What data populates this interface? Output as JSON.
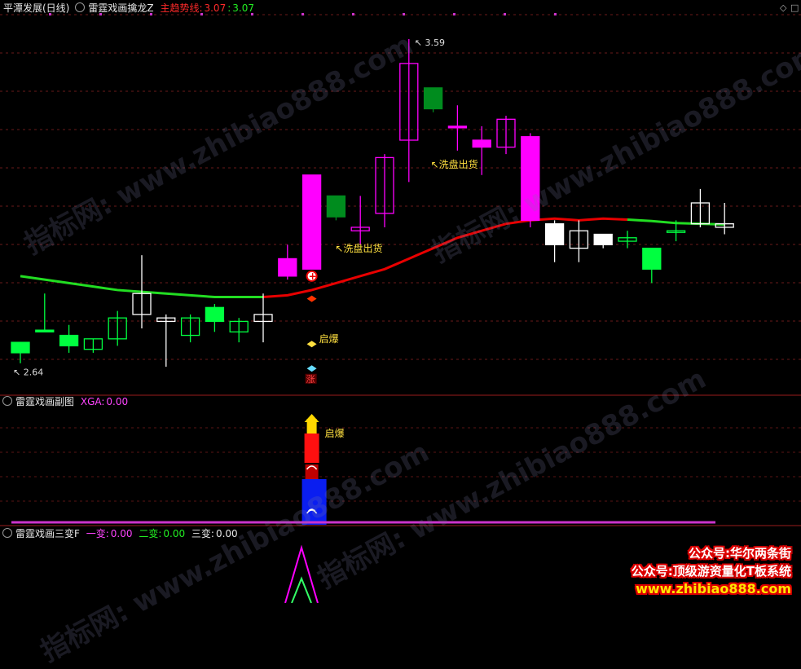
{
  "header_main": {
    "title": "平潭发展(日线)",
    "indicator": "雷霆戏画擒龙Z",
    "trend_label": "主趋势线:",
    "trend_value1": "3.07",
    "sep": ":",
    "trend_value2": "3.07"
  },
  "header_sub1": {
    "indicator": "雷霆戏画副图",
    "xga_label": "XGA:",
    "xga_value": "0.00"
  },
  "header_sub2": {
    "indicator": "雷霆戏画三变F",
    "v1_label": "一变:",
    "v1_value": "0.00",
    "v2_label": "二变:",
    "v2_value": "0.00",
    "v3_label": "三变:",
    "v3_value": "0.00"
  },
  "annotations": {
    "high": "3.59",
    "low": "2.64",
    "wash1": "洗盘出货",
    "wash2": "洗盘出货",
    "qibao1": "启爆",
    "qibao2": "启爆",
    "zhang": "涨"
  },
  "watermarks": [
    "指标网: www.zhibiao888.com",
    "指标网: www.zhibiao888.com",
    "指标网: www.zhibiao888.com",
    "指标网: www.zhibiao888.com"
  ],
  "promo": {
    "line1": "公众号:华尔两条街",
    "line2": "公众号:顶级游资量化T板系统",
    "line3": "www.zhibiao888.com"
  },
  "colors": {
    "up": "#ffffff",
    "down_green": "#00ff40",
    "magenta": "#ff00ff",
    "dark_green": "#008c1e",
    "trend_red": "#e80000",
    "trend_green": "#22dd22",
    "label_yellow": "#ffe040"
  },
  "chart_data": {
    "type": "candlestick",
    "ylim": [
      2.58,
      3.66
    ],
    "candles": [
      {
        "o": 2.72,
        "h": 2.72,
        "l": 2.66,
        "c": 2.69,
        "color": "green"
      },
      {
        "o": 2.75,
        "h": 2.86,
        "l": 2.75,
        "c": 2.755,
        "color": "green"
      },
      {
        "o": 2.74,
        "h": 2.77,
        "l": 2.69,
        "c": 2.71,
        "color": "green"
      },
      {
        "o": 2.7,
        "h": 2.73,
        "l": 2.69,
        "c": 2.73,
        "color": "green_up"
      },
      {
        "o": 2.73,
        "h": 2.81,
        "l": 2.71,
        "c": 2.79,
        "color": "green_up"
      },
      {
        "o": 2.8,
        "h": 2.97,
        "l": 2.76,
        "c": 2.86,
        "color": "white"
      },
      {
        "o": 2.79,
        "h": 2.8,
        "l": 2.65,
        "c": 2.78,
        "color": "white"
      },
      {
        "o": 2.74,
        "h": 2.8,
        "l": 2.72,
        "c": 2.79,
        "color": "green_up"
      },
      {
        "o": 2.82,
        "h": 2.83,
        "l": 2.75,
        "c": 2.78,
        "color": "green"
      },
      {
        "o": 2.75,
        "h": 2.79,
        "l": 2.72,
        "c": 2.78,
        "color": "green_up"
      },
      {
        "o": 2.78,
        "h": 2.86,
        "l": 2.72,
        "c": 2.8,
        "color": "white"
      },
      {
        "o": 2.91,
        "h": 3.0,
        "l": 2.9,
        "c": 2.96,
        "color": "magenta"
      },
      {
        "o": 2.93,
        "h": 3.2,
        "l": 2.93,
        "c": 3.2,
        "color": "magenta"
      },
      {
        "o": 3.14,
        "h": 3.14,
        "l": 3.07,
        "c": 3.08,
        "color": "darkgreen"
      },
      {
        "o": 3.04,
        "h": 3.14,
        "l": 3.0,
        "c": 3.05,
        "color": "magenta"
      },
      {
        "o": 3.09,
        "h": 3.26,
        "l": 3.05,
        "c": 3.25,
        "color": "magenta"
      },
      {
        "o": 3.3,
        "h": 3.59,
        "l": 3.18,
        "c": 3.52,
        "color": "magenta"
      },
      {
        "o": 3.45,
        "h": 3.45,
        "l": 3.38,
        "c": 3.39,
        "color": "darkgreen"
      },
      {
        "o": 3.34,
        "h": 3.4,
        "l": 3.27,
        "c": 3.34,
        "color": "magenta"
      },
      {
        "o": 3.3,
        "h": 3.34,
        "l": 3.2,
        "c": 3.28,
        "color": "magenta"
      },
      {
        "o": 3.28,
        "h": 3.37,
        "l": 3.26,
        "c": 3.36,
        "color": "magenta"
      },
      {
        "o": 3.31,
        "h": 3.32,
        "l": 3.05,
        "c": 3.07,
        "color": "magenta"
      },
      {
        "o": 3.06,
        "h": 3.07,
        "l": 2.95,
        "c": 3.0,
        "color": "white"
      },
      {
        "o": 3.04,
        "h": 3.07,
        "l": 2.95,
        "c": 2.99,
        "color": "white"
      },
      {
        "o": 3.03,
        "h": 3.03,
        "l": 2.99,
        "c": 3.0,
        "color": "white"
      },
      {
        "o": 3.02,
        "h": 3.04,
        "l": 2.99,
        "c": 3.01,
        "color": "green_up"
      },
      {
        "o": 2.99,
        "h": 2.99,
        "l": 2.89,
        "c": 2.93,
        "color": "green"
      },
      {
        "o": 3.04,
        "h": 3.07,
        "l": 3.01,
        "c": 3.04,
        "color": "green_up"
      },
      {
        "o": 3.06,
        "h": 3.16,
        "l": 3.05,
        "c": 3.12,
        "color": "white"
      },
      {
        "o": 3.06,
        "h": 3.12,
        "l": 3.03,
        "c": 3.05,
        "color": "white"
      }
    ],
    "trend_line": [
      2.91,
      2.9,
      2.89,
      2.88,
      2.87,
      2.865,
      2.86,
      2.855,
      2.85,
      2.85,
      2.85,
      2.855,
      2.87,
      2.89,
      2.91,
      2.93,
      2.96,
      2.99,
      3.02,
      3.04,
      3.06,
      3.07,
      3.075,
      3.07,
      3.075,
      3.072,
      3.068,
      3.062,
      3.06,
      3.058
    ]
  }
}
